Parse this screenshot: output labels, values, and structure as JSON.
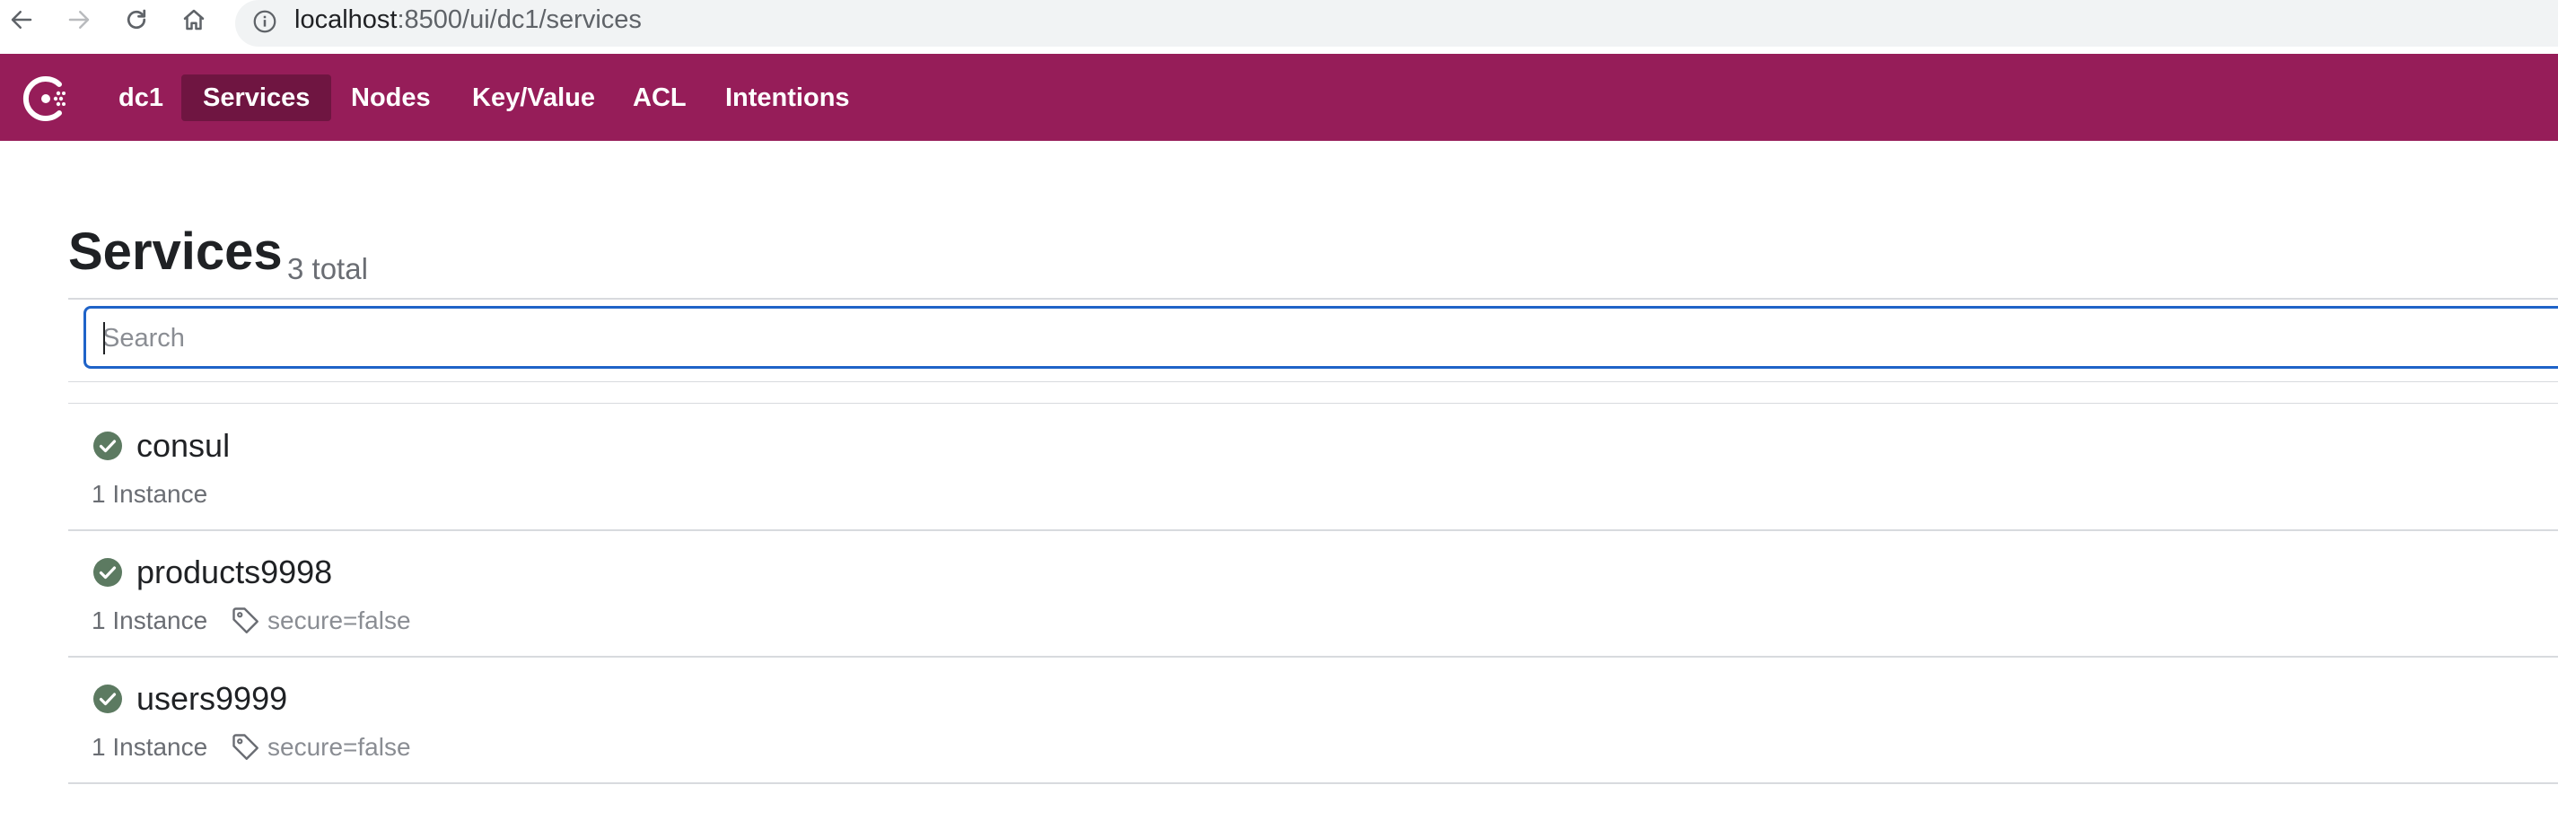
{
  "browser": {
    "url_host": "localhost",
    "url_rest": ":8500/ui/dc1/services"
  },
  "header": {
    "datacenter": "dc1",
    "nav": [
      {
        "label": "Services",
        "active": true
      },
      {
        "label": "Nodes",
        "active": false
      },
      {
        "label": "Key/Value",
        "active": false
      },
      {
        "label": "ACL",
        "active": false
      },
      {
        "label": "Intentions",
        "active": false
      }
    ]
  },
  "page": {
    "title": "Services",
    "count": "3 total"
  },
  "search": {
    "placeholder": "Search",
    "value": ""
  },
  "services": [
    {
      "name": "consul",
      "instances": "1 Instance",
      "tag": "",
      "status": "passing"
    },
    {
      "name": "products9998",
      "instances": "1 Instance",
      "tag": "secure=false",
      "status": "passing"
    },
    {
      "name": "users9999",
      "instances": "1 Instance",
      "tag": "secure=false",
      "status": "passing"
    }
  ],
  "colors": {
    "brand": "#961d59",
    "brand_active": "#6f1541",
    "status_passing": "#5c7a61",
    "focus": "#1f63c8"
  }
}
